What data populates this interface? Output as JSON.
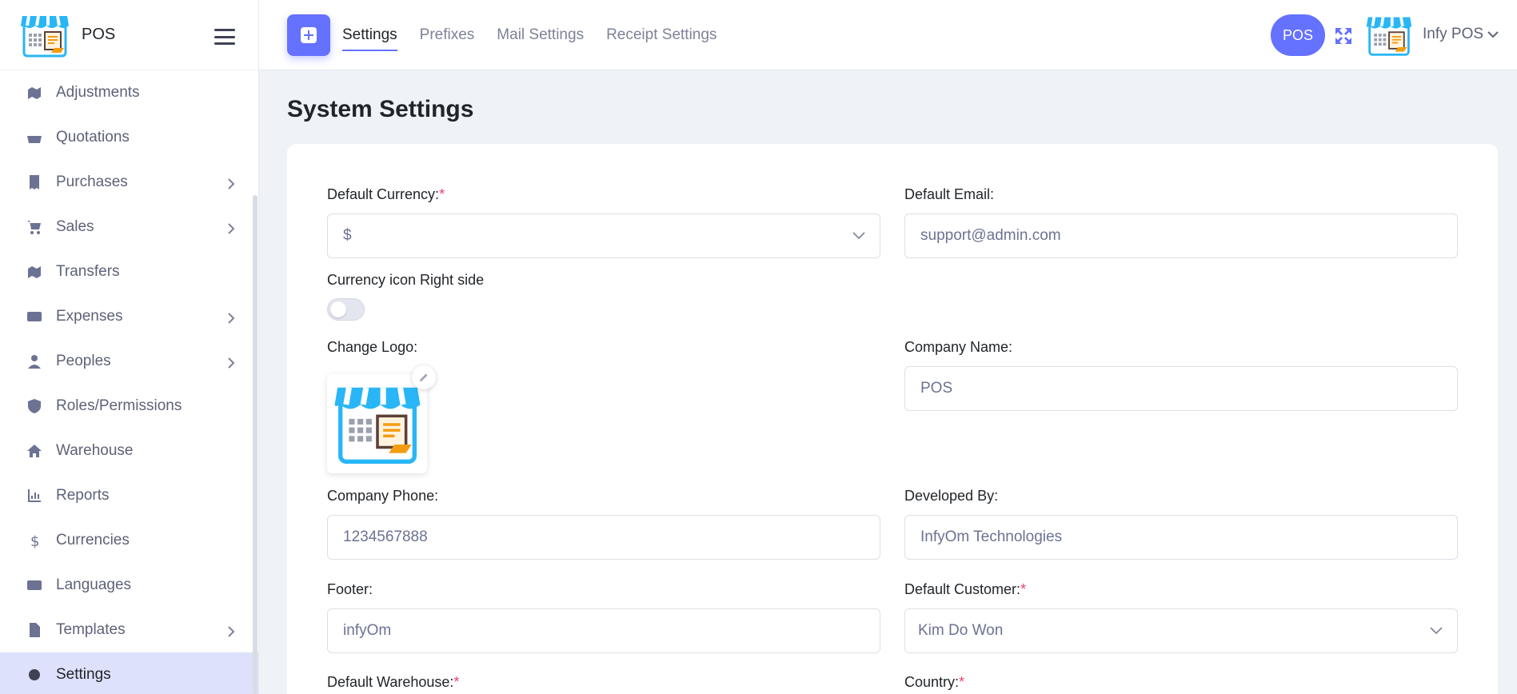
{
  "brand": {
    "name": "POS"
  },
  "sidebar": {
    "items": [
      {
        "label": "Adjustments",
        "icon": "adjustments-icon",
        "has_children": false
      },
      {
        "label": "Quotations",
        "icon": "basket-icon",
        "has_children": false
      },
      {
        "label": "Purchases",
        "icon": "receipt-icon",
        "has_children": true
      },
      {
        "label": "Sales",
        "icon": "cart-icon",
        "has_children": true
      },
      {
        "label": "Transfers",
        "icon": "map-icon",
        "has_children": false
      },
      {
        "label": "Expenses",
        "icon": "money-icon",
        "has_children": true
      },
      {
        "label": "Peoples",
        "icon": "user-icon",
        "has_children": true
      },
      {
        "label": "Roles/Permissions",
        "icon": "shield-icon",
        "has_children": false
      },
      {
        "label": "Warehouse",
        "icon": "home-icon",
        "has_children": false
      },
      {
        "label": "Reports",
        "icon": "chart-icon",
        "has_children": false
      },
      {
        "label": "Currencies",
        "icon": "dollar-icon",
        "has_children": false
      },
      {
        "label": "Languages",
        "icon": "language-icon",
        "has_children": false
      },
      {
        "label": "Templates",
        "icon": "file-icon",
        "has_children": true
      },
      {
        "label": "Settings",
        "icon": "gear-icon",
        "has_children": false,
        "active": true
      }
    ]
  },
  "header": {
    "tabs": [
      {
        "label": "Settings",
        "active": true
      },
      {
        "label": "Prefixes",
        "active": false
      },
      {
        "label": "Mail Settings",
        "active": false
      },
      {
        "label": "Receipt Settings",
        "active": false
      }
    ],
    "pos_badge": "POS",
    "user_name": "Infy POS"
  },
  "main": {
    "title": "System Settings",
    "form": {
      "default_currency_label": "Default Currency:",
      "default_currency_value": "$",
      "default_email_label": "Default Email:",
      "default_email_value": "support@admin.com",
      "currency_icon_label": "Currency icon Right side",
      "currency_icon_right": false,
      "change_logo_label": "Change Logo:",
      "company_name_label": "Company Name:",
      "company_name_value": "POS",
      "company_phone_label": "Company Phone:",
      "company_phone_value": "1234567888",
      "developed_by_label": "Developed By:",
      "developed_by_value": "InfyOm Technologies",
      "footer_label": "Footer:",
      "footer_value": "infyOm",
      "default_customer_label": "Default Customer:",
      "default_customer_value": "Kim Do Won",
      "default_warehouse_label": "Default Warehouse:",
      "country_label": "Country:",
      "required_mark": "*"
    }
  },
  "colors": {
    "accent": "#6571ff",
    "active_nav_bg": "#dde1fb",
    "required": "#f1416c",
    "page_bg": "#eff3f7"
  }
}
